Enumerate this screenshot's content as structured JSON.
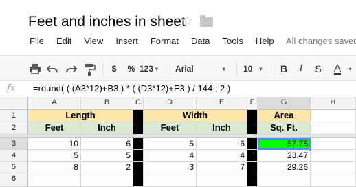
{
  "doc": {
    "title": "Feet and inches in sheet",
    "star_icon": "star-icon",
    "folder_icon": "folder-icon"
  },
  "menu": {
    "items": [
      "File",
      "Edit",
      "View",
      "Insert",
      "Format",
      "Data",
      "Tools",
      "Help"
    ],
    "status": "All changes saved"
  },
  "toolbar": {
    "print_icon": "print-icon",
    "undo_icon": "undo-icon",
    "redo_icon": "redo-icon",
    "paint_format_icon": "paint-format-icon",
    "currency": "$",
    "percent": "%",
    "more_formats": "123",
    "font": "Arial",
    "font_size": "10",
    "bold": "B",
    "italic": "I",
    "strikethrough": "S",
    "text_color": "A",
    "text_color_value": "#000000"
  },
  "formula_bar": {
    "fx": "fx",
    "formula": "=round( ( (A3*12)+B3 ) * ( (D3*12)+E3 ) / 144 ; 2 )"
  },
  "sheet": {
    "columns": [
      "A",
      "B",
      "C",
      "D",
      "E",
      "F",
      "G",
      "H"
    ],
    "rows": [
      "1",
      "2",
      "3",
      "4",
      "5",
      "6"
    ],
    "selected_cell": "G3",
    "headers_row1": {
      "length": "Length",
      "width": "Width",
      "area": "Area"
    },
    "headers_row2": {
      "a": "Feet",
      "b": "Inch",
      "d": "Feet",
      "e": "Inch",
      "g": "Sq. Ft."
    },
    "data": [
      {
        "a": "10",
        "b": "6",
        "d": "5",
        "e": "6",
        "g": "57.75"
      },
      {
        "a": "5",
        "b": "5",
        "d": "4",
        "e": "4",
        "g": "23.47"
      },
      {
        "a": "8",
        "b": "2",
        "d": "3",
        "e": "7",
        "g": "29.26"
      }
    ],
    "colors": {
      "header_yellow": "#fbe6a8",
      "header_green": "#d9ead3",
      "separator": "#000000",
      "highlight": "#00ff00",
      "selection": "#4d90fe"
    }
  }
}
